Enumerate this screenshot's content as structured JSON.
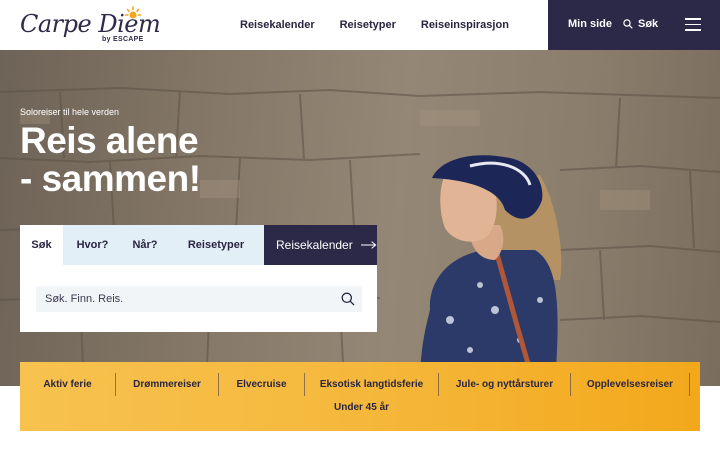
{
  "brand": {
    "name": "Carpe Diem",
    "byline": "by ESCAPE",
    "colors": {
      "navy": "#2c2848",
      "gold": "#f5b83c",
      "light_blue": "#e3eff7"
    }
  },
  "topnav": {
    "items": [
      "Reisekalender",
      "Reisetyper",
      "Reiseinspirasjon"
    ],
    "min_side": "Min side",
    "search_label": "Søk",
    "menu_icon": "hamburger-icon"
  },
  "hero": {
    "kicker": "Soloreiser til hele verden",
    "headline_line1": "Reis alene",
    "headline_line2": "- sammen!"
  },
  "search_box": {
    "tabs": [
      "Søk",
      "Hvor?",
      "Når?",
      "Reisetyper"
    ],
    "active_tab": "Søk",
    "calendar_link": "Reisekalender",
    "placeholder": "Søk. Finn. Reis."
  },
  "categories": {
    "row1": [
      "Aktiv ferie",
      "Drømmereiser",
      "Elvecruise",
      "Eksotisk langtidsferie",
      "Jule- og nyttårsturer",
      "Opplevelsesreiser"
    ],
    "row2": [
      "Under 45 år"
    ]
  }
}
